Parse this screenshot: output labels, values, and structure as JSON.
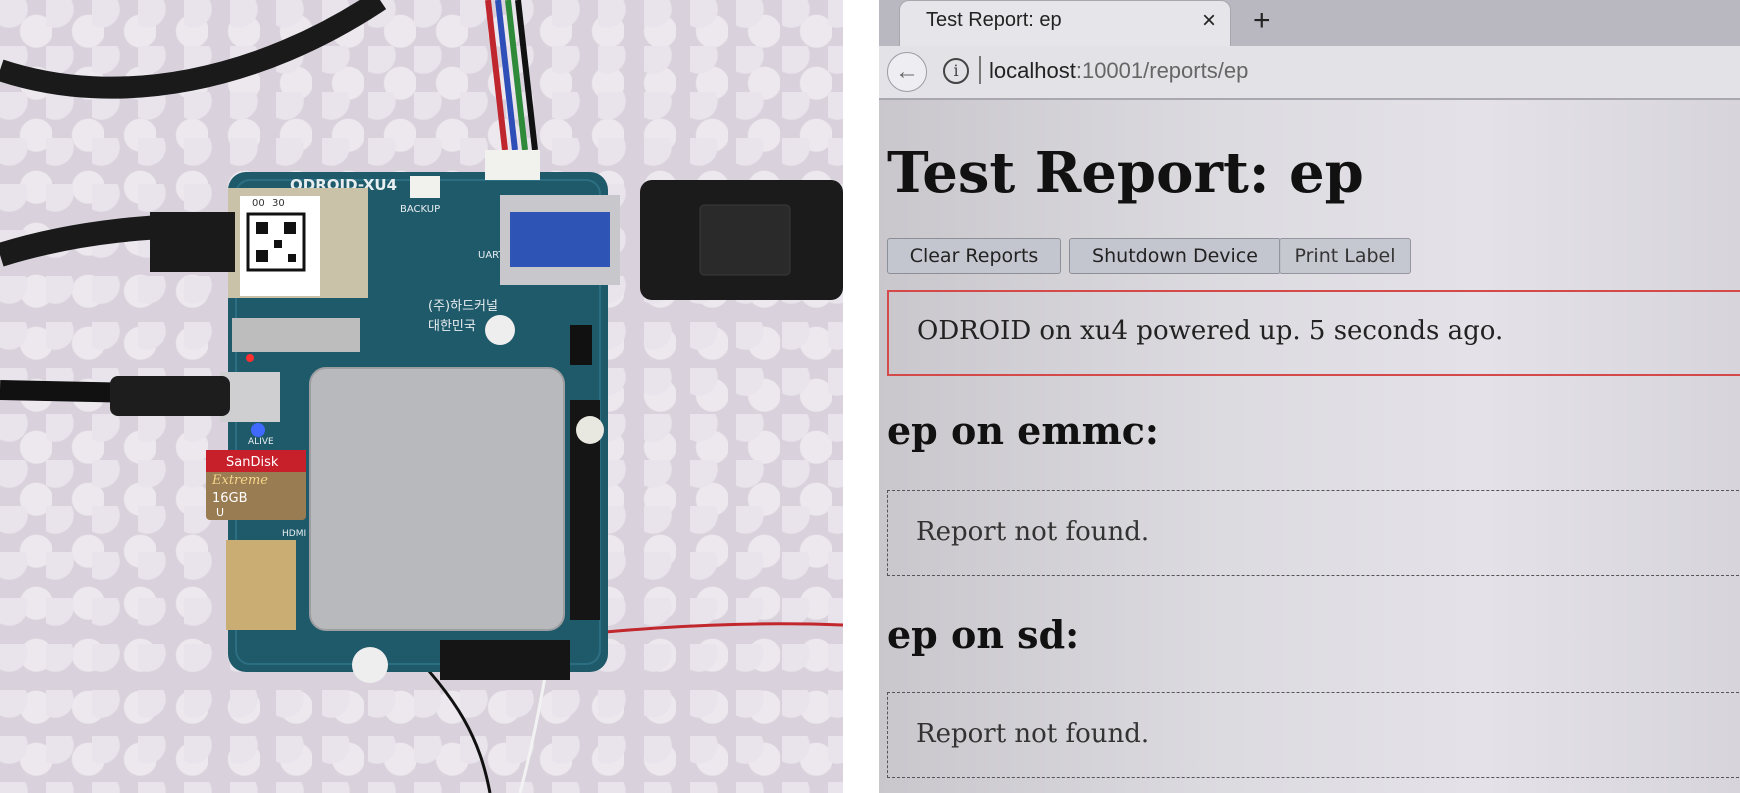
{
  "photo": {
    "board_label": "ODROID-XU4",
    "label_backup": "BACKUP",
    "label_uart": "UART",
    "label_alive": "ALIVE",
    "label_hdmi": "HDMI",
    "korean_company": "(주)하드커널",
    "korean_name": "대한민국",
    "sd_brand": "SanDisk",
    "sd_line": "Extreme",
    "sd_capacity": "16GB",
    "sd_class": "U",
    "qr_text_1": "00",
    "qr_text_2": "30"
  },
  "browser": {
    "tab_title": "Test Report: ep",
    "close_glyph": "×",
    "new_tab_glyph": "+",
    "back_glyph": "←",
    "info_glyph": "i",
    "url_host": "localhost",
    "url_path": ":10001/reports/ep"
  },
  "page": {
    "title": "Test Report: ep",
    "buttons": {
      "clear": "Clear Reports",
      "shutdown": "Shutdown Device",
      "print": "Print Label"
    },
    "status": "ODROID on xu4 powered up. 5 seconds ago.",
    "sections": [
      {
        "heading": "ep on emmc:",
        "message": "Report not found."
      },
      {
        "heading": "ep on sd:",
        "message": "Report not found."
      }
    ]
  },
  "colors": {
    "status_border": "#d44a4a",
    "pcb": "#1f5a6b"
  }
}
